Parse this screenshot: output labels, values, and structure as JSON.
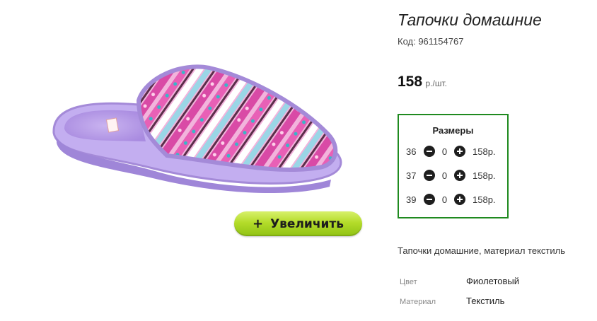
{
  "product": {
    "title": "Тапочки домашние",
    "code": "Код: 961154767",
    "price_value": "158",
    "price_unit": "р./шт.",
    "zoom_label": "Увеличить",
    "description": "Тапочки домашние, материал текстиль"
  },
  "sizes": {
    "title": "Размеры",
    "rows": [
      {
        "size": "36",
        "qty": "0",
        "price": "158р."
      },
      {
        "size": "37",
        "qty": "0",
        "price": "158р."
      },
      {
        "size": "39",
        "qty": "0",
        "price": "158р."
      }
    ]
  },
  "attributes": [
    {
      "label": "Цвет",
      "value": "Фиолетовый"
    },
    {
      "label": "Материал",
      "value": "Текстиль"
    }
  ],
  "colors": {
    "accent_green": "#1f8a1f",
    "button_green": "#b4dc2a",
    "slipper_purple": "#b7a2e6",
    "slipper_pink": "#e86fb8"
  },
  "icons": [
    "plus-icon",
    "minus-circle-icon",
    "plus-circle-icon"
  ]
}
